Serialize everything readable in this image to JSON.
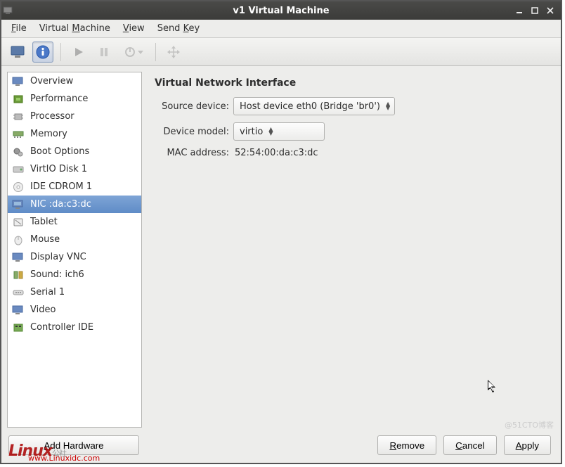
{
  "window": {
    "title": "v1 Virtual Machine"
  },
  "menubar": {
    "file": "File",
    "virtual_machine": "Virtual Machine",
    "view": "View",
    "send_key": "Send Key"
  },
  "sidebar": {
    "items": [
      {
        "label": "Overview",
        "icon": "monitor-icon"
      },
      {
        "label": "Performance",
        "icon": "chip-green-icon"
      },
      {
        "label": "Processor",
        "icon": "cpu-icon"
      },
      {
        "label": "Memory",
        "icon": "ram-icon"
      },
      {
        "label": "Boot Options",
        "icon": "gears-icon"
      },
      {
        "label": "VirtIO Disk 1",
        "icon": "disk-icon"
      },
      {
        "label": "IDE CDROM 1",
        "icon": "cdrom-icon"
      },
      {
        "label": "NIC :da:c3:dc",
        "icon": "nic-icon",
        "selected": true
      },
      {
        "label": "Tablet",
        "icon": "tablet-icon"
      },
      {
        "label": "Mouse",
        "icon": "mouse-icon"
      },
      {
        "label": "Display VNC",
        "icon": "display-icon"
      },
      {
        "label": "Sound: ich6",
        "icon": "sound-icon"
      },
      {
        "label": "Serial 1",
        "icon": "serial-icon"
      },
      {
        "label": "Video",
        "icon": "video-icon"
      },
      {
        "label": "Controller IDE",
        "icon": "controller-icon"
      }
    ]
  },
  "main": {
    "section_title": "Virtual Network Interface",
    "source_device_label": "Source device:",
    "source_device_value": "Host device eth0 (Bridge 'br0')",
    "device_model_label": "Device model:",
    "device_model_value": "virtio",
    "mac_address_label": "MAC address:",
    "mac_address_value": "52:54:00:da:c3:dc"
  },
  "footer": {
    "add_hardware": "Add Hardware",
    "remove": "Remove",
    "cancel": "Cancel",
    "apply": "Apply"
  },
  "watermarks": {
    "brand": "Linux",
    "brand_sub": "公社",
    "url": "www.Linuxidc.com",
    "cto": "@51CTO博客"
  }
}
